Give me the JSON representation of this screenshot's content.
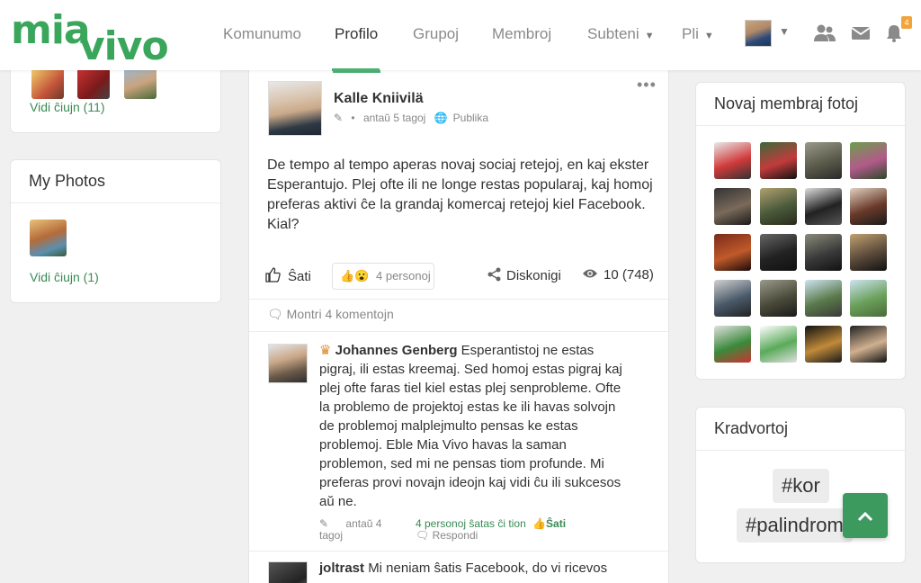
{
  "logo": {
    "part1": "mia",
    "part2": "vivo"
  },
  "nav": [
    {
      "label": "Komunumo",
      "dropdown": false
    },
    {
      "label": "Profilo",
      "dropdown": false,
      "active": true
    },
    {
      "label": "Grupoj",
      "dropdown": false
    },
    {
      "label": "Membroj",
      "dropdown": false
    },
    {
      "label": "Subteni",
      "dropdown": true
    },
    {
      "label": "Pli",
      "dropdown": true
    }
  ],
  "header_icons": {
    "members": "users-icon",
    "messages": "envelope-icon",
    "notifications": "bell-icon",
    "notification_count": "4"
  },
  "friends_card": {
    "see_all": "Vidi ĉiujn (11)"
  },
  "photos_card": {
    "title": "My Photos",
    "see_all": "Vidi ĉiujn (1)"
  },
  "post": {
    "author": "Kalle Kniivilä",
    "time": "antaŭ 5 tagoj",
    "visibility": "Publika",
    "body": "De tempo al tempo aperas novaj sociaj retejoj, en kaj ekster Esperantujo. Plej ofte ili ne longe restas popularaj, kaj homoj preferas aktivi ĉe la grandaj komercaj retejoj kiel Facebook. Kial?",
    "like_label": "Ŝati",
    "reactions_count": "4 personoj",
    "discuss_label": "Diskonigi",
    "views": "10 (748)",
    "show_comments": "Montri 4 komentojn"
  },
  "comments": [
    {
      "author": "Johannes Genberg",
      "text": "Esperantistoj ne estas pigraj, ili estas kreemaj. Sed homoj estas pigraj kaj plej ofte faras tiel kiel estas plej senprobleme. Ofte la problemo de projektoj estas ke ili havas solvojn de problemoj malplejmulto pensas ke estas problemoj. Eble Mia Vivo havas la saman problemon, sed mi ne pensas tiom profunde. Mi preferas provi novajn ideojn kaj vidi ĉu ili sukcesos aŭ ne.",
      "time_line1": "antaŭ 4",
      "time_line2": "tagoj",
      "likes": "4 personoj ŝatas ĉi tion",
      "like_label": "Ŝati",
      "reply_label": "Respondi"
    },
    {
      "author": "joltrast",
      "text": "Mi neniam ŝatis Facebook, do vi ricevos"
    }
  ],
  "new_photos_card": {
    "title": "Novaj membraj fotoj"
  },
  "tags_card": {
    "title": "Kradvortoj",
    "tags": [
      "#kor",
      "#palindrom"
    ]
  },
  "colors": {
    "brand_green": "#3aa65c",
    "link_green": "#3a8a55",
    "badge_orange": "#f2a33a",
    "scroll_btn": "#3d9a5f"
  }
}
